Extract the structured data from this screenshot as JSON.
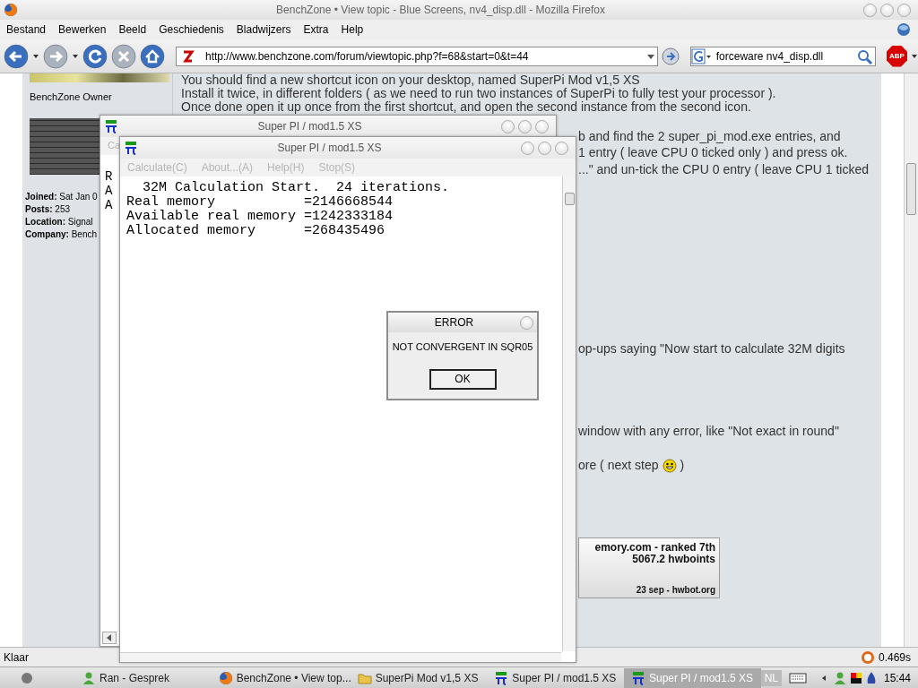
{
  "browser": {
    "title": "BenchZone • View topic - Blue Screens, nv4_disp.dll - Mozilla Firefox",
    "menu": [
      "Bestand",
      "Bewerken",
      "Beeld",
      "Geschiedenis",
      "Bladwijzers",
      "Extra",
      "Help"
    ],
    "url": "http://www.benchzone.com/forum/viewtopic.php?f=68&start=0&t=44",
    "search": "forceware nv4_disp.dll",
    "adblock": "ABP",
    "status": "Klaar",
    "timer": "0.469s"
  },
  "page": {
    "sidebar": {
      "rank": "BenchZone Owner",
      "profile": [
        {
          "label": "Joined:",
          "value": "Sat Jan 0"
        },
        {
          "label": "Posts:",
          "value": "253"
        },
        {
          "label": "Location:",
          "value": "Signal"
        },
        {
          "label": "Company:",
          "value": "Bench"
        }
      ]
    },
    "post": [
      {
        "kind": "full",
        "text": "You should find a new shortcut icon on your desktop, named SuperPi Mod v1,5 XS"
      },
      {
        "kind": "full",
        "text": "Install it twice, in different folders ( as we need to run two instances of SuperPi to fully test your processor )."
      },
      {
        "kind": "full",
        "text": "Once done open it up once from the first shortcut, and open the second instance from the second icon."
      },
      {
        "kind": "partial",
        "text": "b and find the 2 super_pi_mod.exe entries, and"
      },
      {
        "kind": "partial",
        "text": "1 entry ( leave CPU 0 ticked only ) and press ok."
      },
      {
        "kind": "partial",
        "text": "...\" and un-tick the CPU 0 entry ( leave CPU 1 ticked"
      },
      {
        "kind": "partial",
        "text": "op-ups saying \"Now start to calculate 32M digits"
      },
      {
        "kind": "partial",
        "text": "window with any error, like \"Not exact in round\""
      },
      {
        "kind": "smiley",
        "text": "ore ( next step",
        "after": ")"
      }
    ],
    "signature": [
      "emory.com - ranked 7th",
      "5067.2 hwboints",
      "23 sep - hwbot.org"
    ]
  },
  "windows": [
    {
      "title": "Super PI / mod1.5 XS",
      "menu": [
        {
          "label": "Ca",
          "disabled": true
        }
      ],
      "output": [
        "R",
        "A",
        "A"
      ]
    },
    {
      "title": "Super PI / mod1.5 XS",
      "menu": [
        {
          "label": "Calculate(C)",
          "disabled": true
        },
        {
          "label": "About...(A)",
          "disabled": true
        },
        {
          "label": "Help(H)",
          "disabled": true
        },
        {
          "label": "Stop(S)",
          "disabled": true
        }
      ],
      "output": [
        "  32M Calculation Start.  24 iterations.",
        "Real memory           =2146668544",
        "Available real memory =1242333184",
        "Allocated memory      =268435496"
      ]
    }
  ],
  "dialog": {
    "title": "ERROR",
    "message": "NOT CONVERGENT IN SQR05",
    "button": "OK"
  },
  "taskbar": {
    "items": [
      {
        "label": "Ran - Gesprek",
        "selected": false
      },
      {
        "label": "BenchZone • View top...",
        "selected": false
      },
      {
        "label": "SuperPi Mod v1,5 XS",
        "selected": false
      },
      {
        "label": "Super PI / mod1.5 XS",
        "selected": false
      },
      {
        "label": "Super PI / mod1.5 XS",
        "selected": true
      }
    ],
    "language": "NL",
    "clock": "15:44"
  }
}
